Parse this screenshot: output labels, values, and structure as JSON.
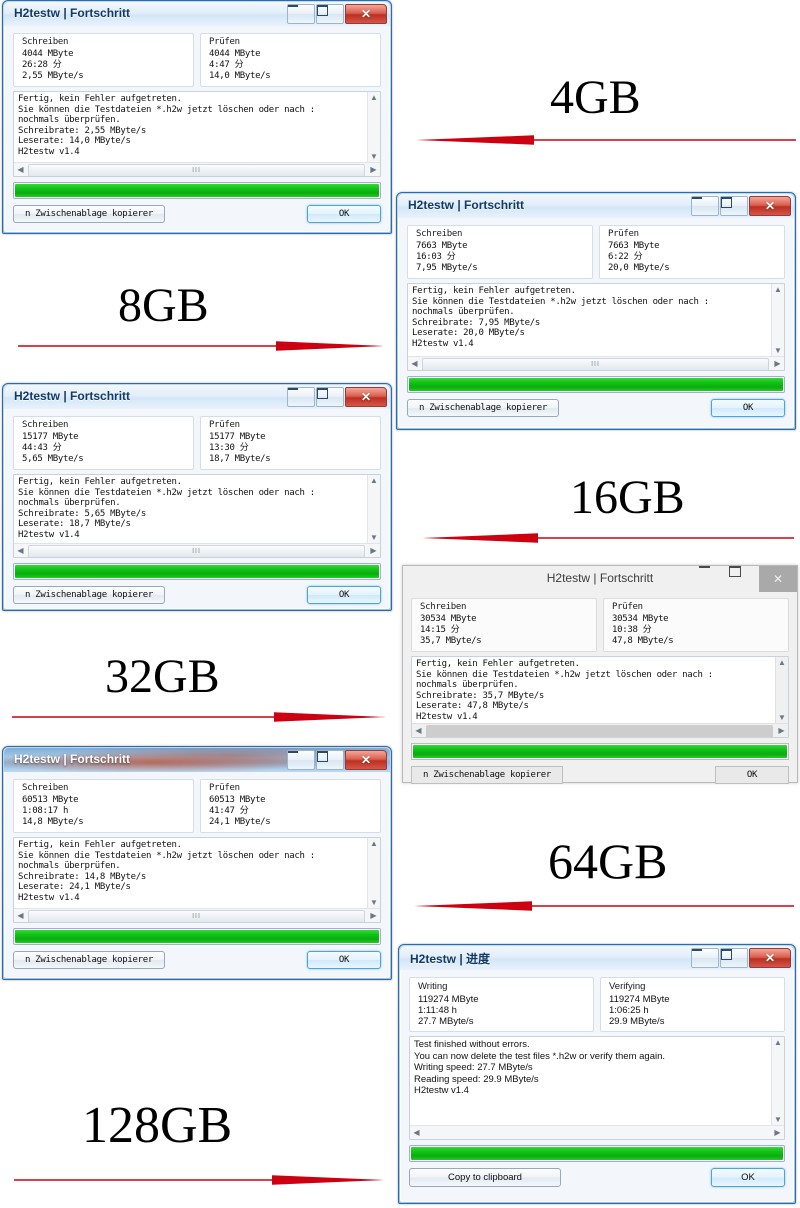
{
  "page": {
    "description": "Collage of six H2testw progress dialogs for different flash drive capacities",
    "background": "#ffffff",
    "arrow_color": "#cc0011"
  },
  "windows": [
    {
      "id": "win-4gb",
      "style": "aero",
      "lang": "de",
      "title": "H2testw | Fortschritt",
      "controls": {
        "minimize": "–",
        "maximize": "□",
        "close": "✕"
      },
      "write": {
        "label": "Schreiben",
        "size": "4044 MByte",
        "time": "26:28 分",
        "speed": "2,55 MByte/s"
      },
      "verify": {
        "label": "Prüfen",
        "size": "4044 MByte",
        "time": "4:47 分",
        "speed": "14,0 MByte/s"
      },
      "log": [
        "Fertig, kein Fehler aufgetreten.",
        "Sie können die Testdateien *.h2w jetzt löschen oder nach :",
        "nochmals überprüfen.",
        "Schreibrate: 2,55 MByte/s",
        "Leserate: 14,0 MByte/s",
        "H2testw v1.4"
      ],
      "progress_percent": 100,
      "copy_button": "n Zwischenablage kopierer",
      "ok_button": "OK"
    },
    {
      "id": "win-8gb",
      "style": "aero",
      "lang": "de",
      "title": "H2testw | Fortschritt",
      "controls": {
        "minimize": "–",
        "maximize": "□",
        "close": "✕"
      },
      "write": {
        "label": "Schreiben",
        "size": "7663 MByte",
        "time": "16:03 分",
        "speed": "7,95 MByte/s"
      },
      "verify": {
        "label": "Prüfen",
        "size": "7663 MByte",
        "time": "6:22 分",
        "speed": "20,0 MByte/s"
      },
      "log": [
        "Fertig, kein Fehler aufgetreten.",
        "Sie können die Testdateien *.h2w jetzt löschen oder nach :",
        "nochmals überprüfen.",
        "Schreibrate: 7,95 MByte/s",
        "Leserate: 20,0 MByte/s",
        "H2testw v1.4"
      ],
      "progress_percent": 100,
      "copy_button": "n Zwischenablage kopierer",
      "ok_button": "OK"
    },
    {
      "id": "win-16gb",
      "style": "aero",
      "lang": "de",
      "title": "H2testw | Fortschritt",
      "controls": {
        "minimize": "–",
        "maximize": "□",
        "close": "✕"
      },
      "write": {
        "label": "Schreiben",
        "size": "15177 MByte",
        "time": "44:43 分",
        "speed": "5,65 MByte/s"
      },
      "verify": {
        "label": "Prüfen",
        "size": "15177 MByte",
        "time": "13:30 分",
        "speed": "18,7 MByte/s"
      },
      "log": [
        "Fertig, kein Fehler aufgetreten.",
        "Sie können die Testdateien *.h2w jetzt löschen oder nach :",
        "nochmals überprüfen.",
        "Schreibrate: 5,65 MByte/s",
        "Leserate: 18,7 MByte/s",
        "H2testw v1.4"
      ],
      "progress_percent": 100,
      "copy_button": "n Zwischenablage kopierer",
      "ok_button": "OK"
    },
    {
      "id": "win-32gb",
      "style": "flat",
      "lang": "de",
      "title": "H2testw | Fortschritt",
      "controls": {
        "minimize": "–",
        "maximize": "□",
        "close": "✕"
      },
      "write": {
        "label": "Schreiben",
        "size": "30534 MByte",
        "time": "14:15 分",
        "speed": "35,7 MByte/s"
      },
      "verify": {
        "label": "Prüfen",
        "size": "30534 MByte",
        "time": "10:38 分",
        "speed": "47,8 MByte/s"
      },
      "log": [
        "Fertig, kein Fehler aufgetreten.",
        "Sie können die Testdateien *.h2w jetzt löschen oder nach :",
        "nochmals überprüfen.",
        "Schreibrate: 35,7 MByte/s",
        "Leserate: 47,8 MByte/s",
        "H2testw v1.4"
      ],
      "progress_percent": 100,
      "copy_button": "n Zwischenablage kopierer",
      "ok_button": "OK"
    },
    {
      "id": "win-64gb",
      "style": "aero-glass",
      "lang": "de",
      "title": "H2testw | Fortschritt",
      "controls": {
        "minimize": "–",
        "maximize": "□",
        "close": "✕"
      },
      "write": {
        "label": "Schreiben",
        "size": "60513 MByte",
        "time": "1:08:17 h",
        "speed": "14,8 MByte/s"
      },
      "verify": {
        "label": "Prüfen",
        "size": "60513 MByte",
        "time": "41:47 分",
        "speed": "24,1 MByte/s"
      },
      "log": [
        "Fertig, kein Fehler aufgetreten.",
        "Sie können die Testdateien *.h2w jetzt löschen oder nach :",
        "nochmals überprüfen.",
        "Schreibrate: 14,8 MByte/s",
        "Leserate: 24,1 MByte/s",
        "H2testw v1.4"
      ],
      "progress_percent": 100,
      "copy_button": "n Zwischenablage kopierer",
      "ok_button": "OK"
    },
    {
      "id": "win-128gb",
      "style": "aero",
      "lang": "en",
      "title": "H2testw | 进度",
      "controls": {
        "minimize": "–",
        "maximize": "□",
        "close": "✕"
      },
      "write": {
        "label": "Writing",
        "size": "119274 MByte",
        "time": "1:11:48 h",
        "speed": "27.7 MByte/s"
      },
      "verify": {
        "label": "Verifying",
        "size": "119274 MByte",
        "time": "1:06:25 h",
        "speed": "29.9 MByte/s"
      },
      "log": [
        "Test finished without errors.",
        "You can now delete the test files *.h2w or verify them again.",
        "Writing speed: 27.7 MByte/s",
        "Reading speed: 29.9 MByte/s",
        "H2testw v1.4"
      ],
      "progress_percent": 100,
      "copy_button": "Copy to clipboard",
      "ok_button": "OK"
    }
  ],
  "annotations": [
    {
      "id": "cap-4gb",
      "label": "4GB",
      "arrow_direction": "left"
    },
    {
      "id": "cap-8gb",
      "label": "8GB",
      "arrow_direction": "right"
    },
    {
      "id": "cap-16gb",
      "label": "16GB",
      "arrow_direction": "left"
    },
    {
      "id": "cap-32gb",
      "label": "32GB",
      "arrow_direction": "right"
    },
    {
      "id": "cap-64gb",
      "label": "64GB",
      "arrow_direction": "left"
    },
    {
      "id": "cap-128gb",
      "label": "128GB",
      "arrow_direction": "right"
    }
  ]
}
